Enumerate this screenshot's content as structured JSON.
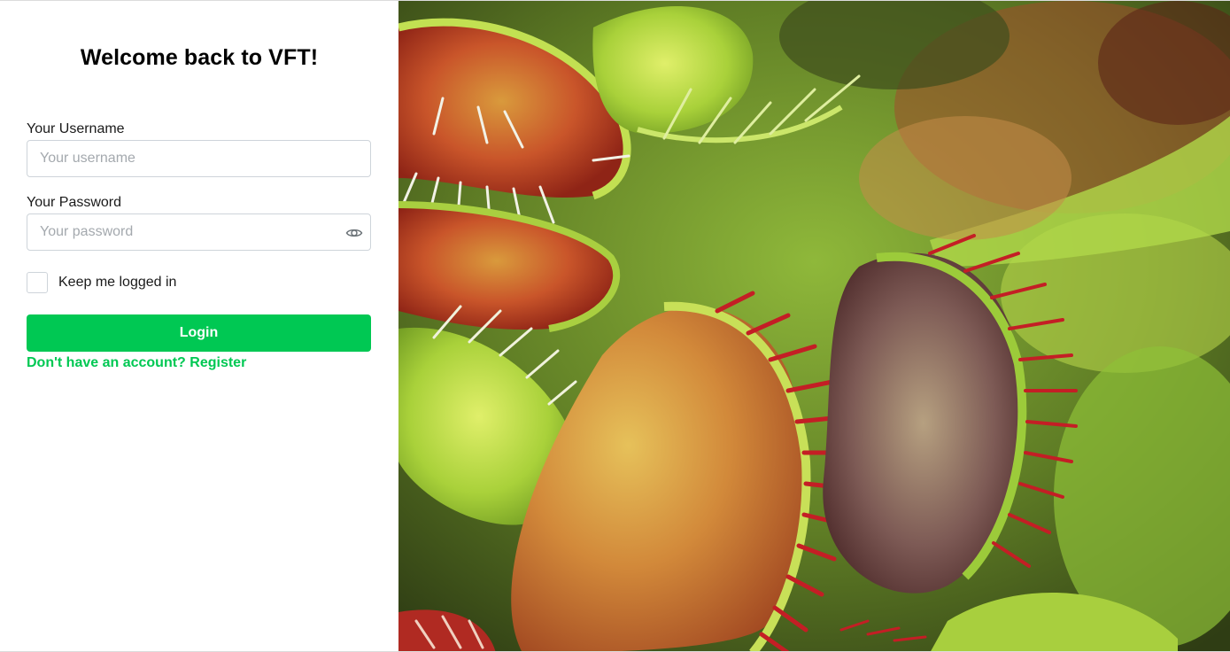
{
  "login": {
    "title": "Welcome back to VFT!",
    "username_label": "Your Username",
    "username_placeholder": "Your username",
    "password_label": "Your Password",
    "password_placeholder": "Your password",
    "remember_label": "Keep me logged in",
    "remember_checked": false,
    "login_button": "Login",
    "register_link": "Don't have an account? Register"
  },
  "icons": {
    "password_toggle": "eye-icon"
  },
  "colors": {
    "accent": "#00c853",
    "input_border": "#ced4da",
    "placeholder": "#a4a9ae"
  }
}
